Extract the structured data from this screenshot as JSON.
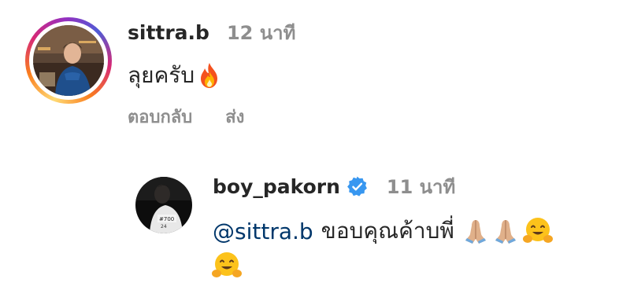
{
  "comments": [
    {
      "username": "sittra.b",
      "time": "12 นาที",
      "text": "ลุยครับ",
      "emoji": "fire-emoji",
      "has_story_ring": true,
      "actions": {
        "reply": "ตอบกลับ",
        "send": "ส่ง"
      }
    },
    {
      "username": "boy_pakorn",
      "verified": true,
      "time": "11 นาที",
      "mention": "@sittra.b",
      "text": "ขอบคุณค้าบพี่",
      "emoji": [
        "folded-hands-emoji",
        "folded-hands-emoji",
        "hugging-face-emoji",
        "hugging-face-emoji"
      ]
    }
  ],
  "colors": {
    "text": "#262626",
    "muted": "#8e8e8e",
    "mention": "#00376b",
    "verified": "#3897f0"
  }
}
